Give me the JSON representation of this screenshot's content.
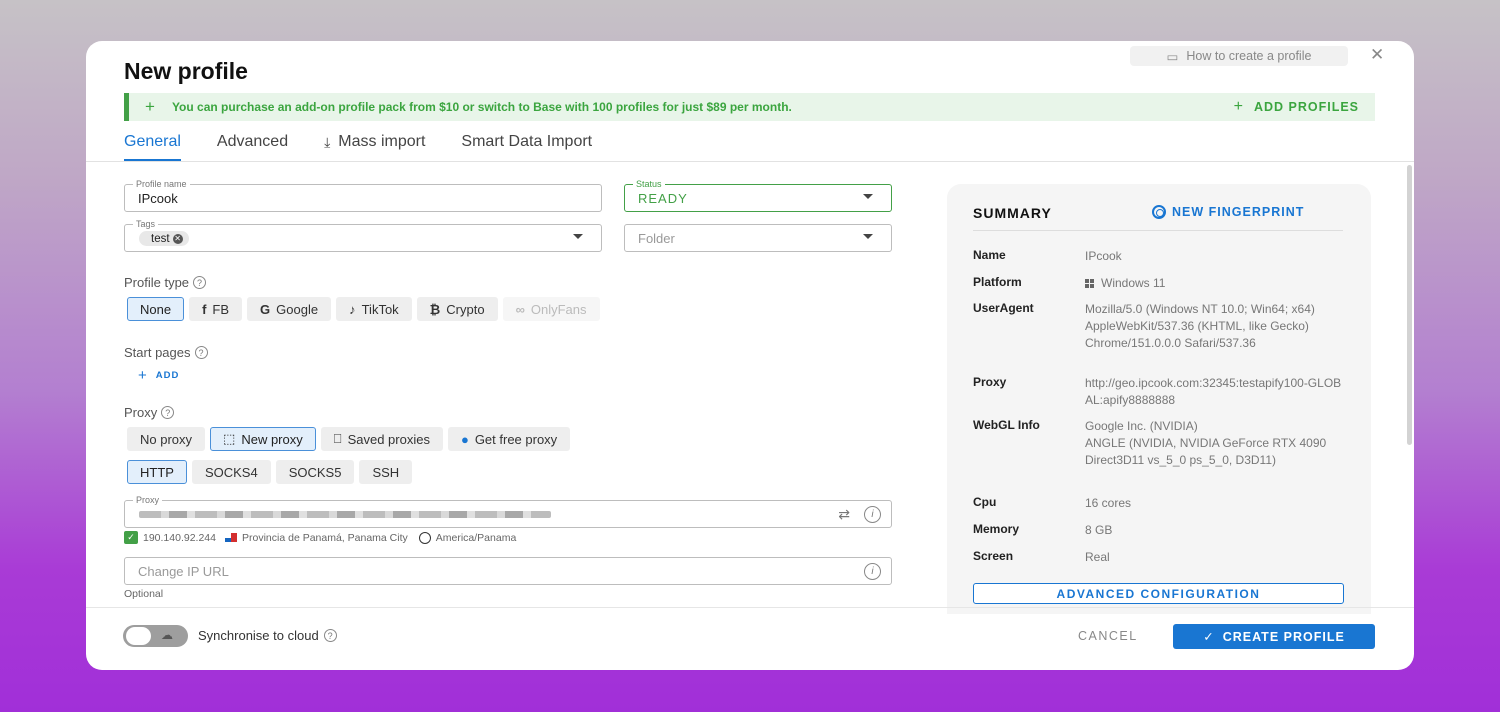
{
  "header": {
    "title": "New profile",
    "help_label": "How to create a profile",
    "close_icon": "close-icon"
  },
  "banner": {
    "text": "You can purchase an add-on profile pack from $10 or switch to Base with 100 profiles for just $89 per month.",
    "action_label": "ADD PROFILES",
    "color": "#43a047"
  },
  "tabs": [
    {
      "label": "General",
      "active": true
    },
    {
      "label": "Advanced"
    },
    {
      "label": "Mass import",
      "icon": "download-icon"
    },
    {
      "label": "Smart Data Import"
    }
  ],
  "form": {
    "profile_name": {
      "legend": "Profile name",
      "value": "IPcook"
    },
    "status": {
      "legend": "Status",
      "value": "READY"
    },
    "tags": {
      "legend": "Tags",
      "chips": [
        "test"
      ]
    },
    "folder": {
      "placeholder": "Folder"
    },
    "profile_type": {
      "label": "Profile type",
      "options": [
        "None",
        "FB",
        "Google",
        "TikTok",
        "Crypto",
        "OnlyFans"
      ],
      "selected": "None"
    },
    "start_pages": {
      "label": "Start pages",
      "add_label": "ADD"
    },
    "proxy": {
      "label": "Proxy",
      "modes": [
        "No proxy",
        "New proxy",
        "Saved proxies",
        "Get free proxy"
      ],
      "selected_mode": "New proxy",
      "protocols": [
        "HTTP",
        "SOCKS4",
        "SOCKS5",
        "SSH"
      ],
      "selected_protocol": "HTTP",
      "field_legend": "Proxy",
      "ip": "190.140.92.244",
      "location": "Provincia de Panamá, Panama City",
      "timezone": "America/Panama"
    },
    "change_ip": {
      "placeholder": "Change IP URL",
      "helper": "Optional"
    }
  },
  "summary": {
    "title": "SUMMARY",
    "new_fingerprint_label": "NEW FINGERPRINT",
    "rows": [
      {
        "key": "Name",
        "value": "IPcook"
      },
      {
        "key": "Platform",
        "value": "Windows 11"
      },
      {
        "key": "UserAgent",
        "value": "Mozilla/5.0 (Windows NT 10.0; Win64; x64) AppleWebKit/537.36 (KHTML, like Gecko) Chrome/151.0.0.0 Safari/537.36"
      },
      {
        "key": "Proxy",
        "value": "http://geo.ipcook.com:32345:testapify100-GLOBAL:apify8888888"
      },
      {
        "key": "WebGL Info",
        "value": "Google Inc. (NVIDIA)",
        "value2": "ANGLE (NVIDIA, NVIDIA GeForce RTX 4090 Direct3D11 vs_5_0 ps_5_0, D3D11)"
      },
      {
        "key": "Cpu",
        "value": "16 cores"
      },
      {
        "key": "Memory",
        "value": "8 GB"
      },
      {
        "key": "Screen",
        "value": "Real"
      }
    ],
    "advanced_label": "ADVANCED CONFIGURATION"
  },
  "footer": {
    "sync_label": "Synchronise to cloud",
    "cancel_label": "CANCEL",
    "create_label": "CREATE PROFILE",
    "primary_color": "#1976d2"
  }
}
